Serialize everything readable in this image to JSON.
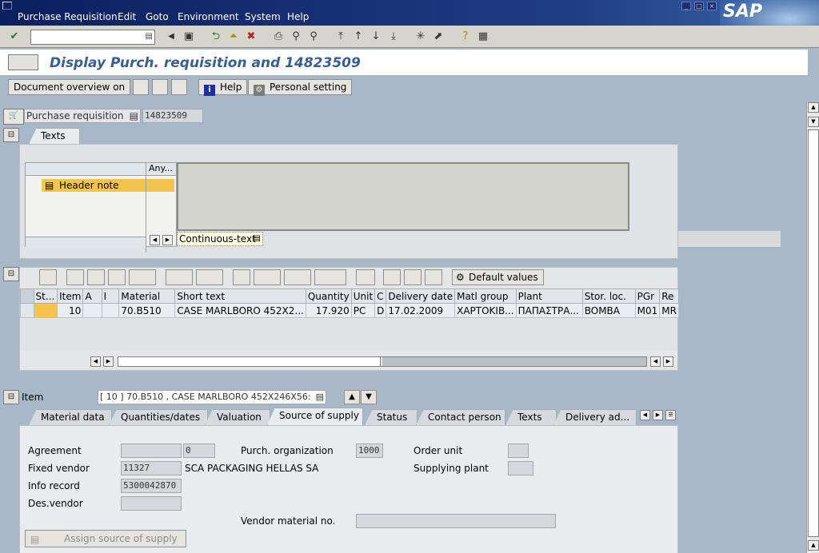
{
  "menu": {
    "items": [
      "Purchase Requisition",
      "Edit",
      "Goto",
      "Environment",
      "System",
      "Help"
    ]
  },
  "logo": "SAP",
  "toolbar": {
    "command_value": ""
  },
  "page": {
    "title": "Display Purch. requisition and 14823509"
  },
  "app_toolbar": {
    "document_overview": "Document overview on",
    "help": "Help",
    "personal_setting": "Personal setting"
  },
  "header": {
    "pr_type": "Purchase requisition",
    "pr_number": "14823509",
    "tab_texts": "Texts",
    "col_any": "Any...",
    "header_note": "Header note",
    "text_mode": "Continuous-text"
  },
  "items_toolbar": {
    "default_values": "Default values"
  },
  "items_table": {
    "columns": [
      "St...",
      "Item",
      "A",
      "I",
      "Material",
      "Short text",
      "Quantity",
      "Unit",
      "C",
      "Delivery date",
      "Matl group",
      "Plant",
      "Stor. loc.",
      "PGr",
      "Re"
    ],
    "rows": [
      [
        "",
        "10",
        "",
        "",
        "70.B510",
        "CASE MARLBORO 452X2...",
        "17.920",
        "PC",
        "D",
        "17.02.2009",
        "ΧΑΡΤΟΚΙΒ...",
        "ΠΑΠΑΣΤΡΑ...",
        "BOMBA",
        "M01",
        "MR"
      ]
    ]
  },
  "item_detail": {
    "label": "Item",
    "selector_value": "[ 10 ] 70.B510 , CASE MARLBORO 452X246X56:",
    "tabs": [
      "Material data",
      "Quantities/dates",
      "Valuation",
      "Source of supply",
      "Status",
      "Contact person",
      "Texts",
      "Delivery ad..."
    ],
    "active_tab": "Source of supply"
  },
  "source_of_supply": {
    "agreement_label": "Agreement",
    "agreement_value": "",
    "agreement_item": "0",
    "fixed_vendor_label": "Fixed vendor",
    "fixed_vendor_value": "11327",
    "fixed_vendor_name": "SCA PACKAGING HELLAS SA",
    "info_record_label": "Info record",
    "info_record_value": "5300042870",
    "des_vendor_label": "Des.vendor",
    "des_vendor_value": "",
    "purch_org_label": "Purch. organization",
    "purch_org_value": "1000",
    "order_unit_label": "Order unit",
    "order_unit_value": "",
    "supplying_plant_label": "Supplying plant",
    "supplying_plant_value": "",
    "vendor_material_label": "Vendor material no.",
    "vendor_material_value": "",
    "assign_button": "Assign source of supply"
  },
  "colors": {
    "title_blue": "#385e97",
    "menubar": "#1f3d85",
    "background": "#a8b8c8",
    "highlight": "#f4c44c"
  }
}
